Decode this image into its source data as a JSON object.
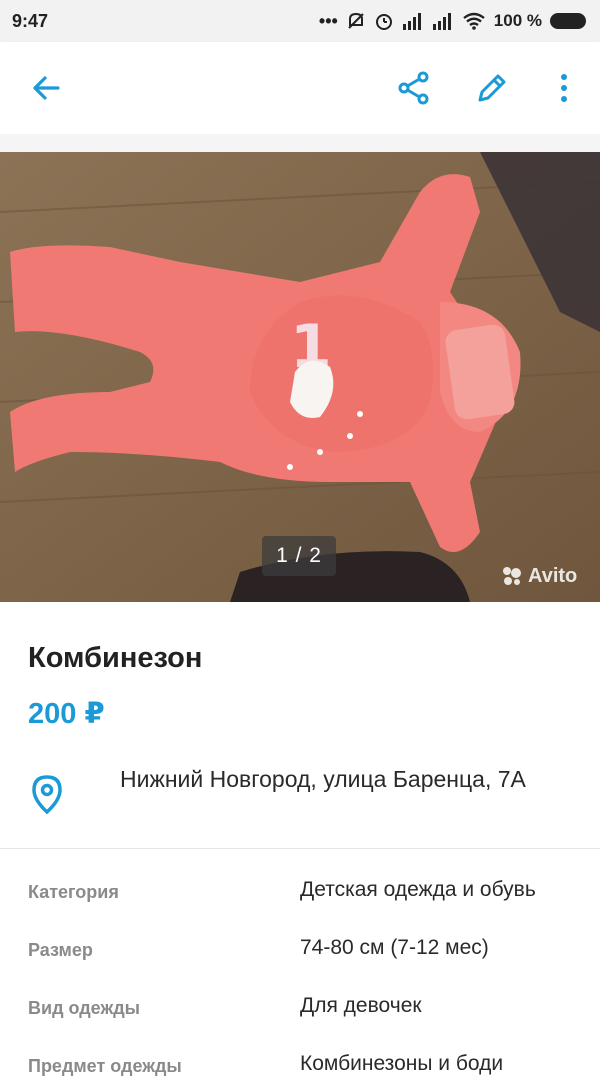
{
  "status_bar": {
    "time": "9:47",
    "indicators": "••• ",
    "battery_text": "100 %"
  },
  "app_bar": {
    "back_icon": "arrow-left-icon",
    "share_icon": "share-icon",
    "edit_icon": "pencil-icon",
    "more_icon": "more-vertical-icon",
    "accent_color": "#1a9ad6"
  },
  "gallery": {
    "counter": "1 / 2",
    "watermark": "Avito"
  },
  "listing": {
    "title": "Комбинезон",
    "price": "200 ₽",
    "address": "Нижний Новгород, улица Баренца, 7А"
  },
  "properties": [
    {
      "key": "Категория",
      "value": "Детская одежда и обувь"
    },
    {
      "key": "Размер",
      "value": "74-80 см (7-12 мес)"
    },
    {
      "key": "Вид одежды",
      "value": "Для девочек"
    },
    {
      "key": "Предмет одежды",
      "value": "Комбинезоны и боди"
    }
  ]
}
